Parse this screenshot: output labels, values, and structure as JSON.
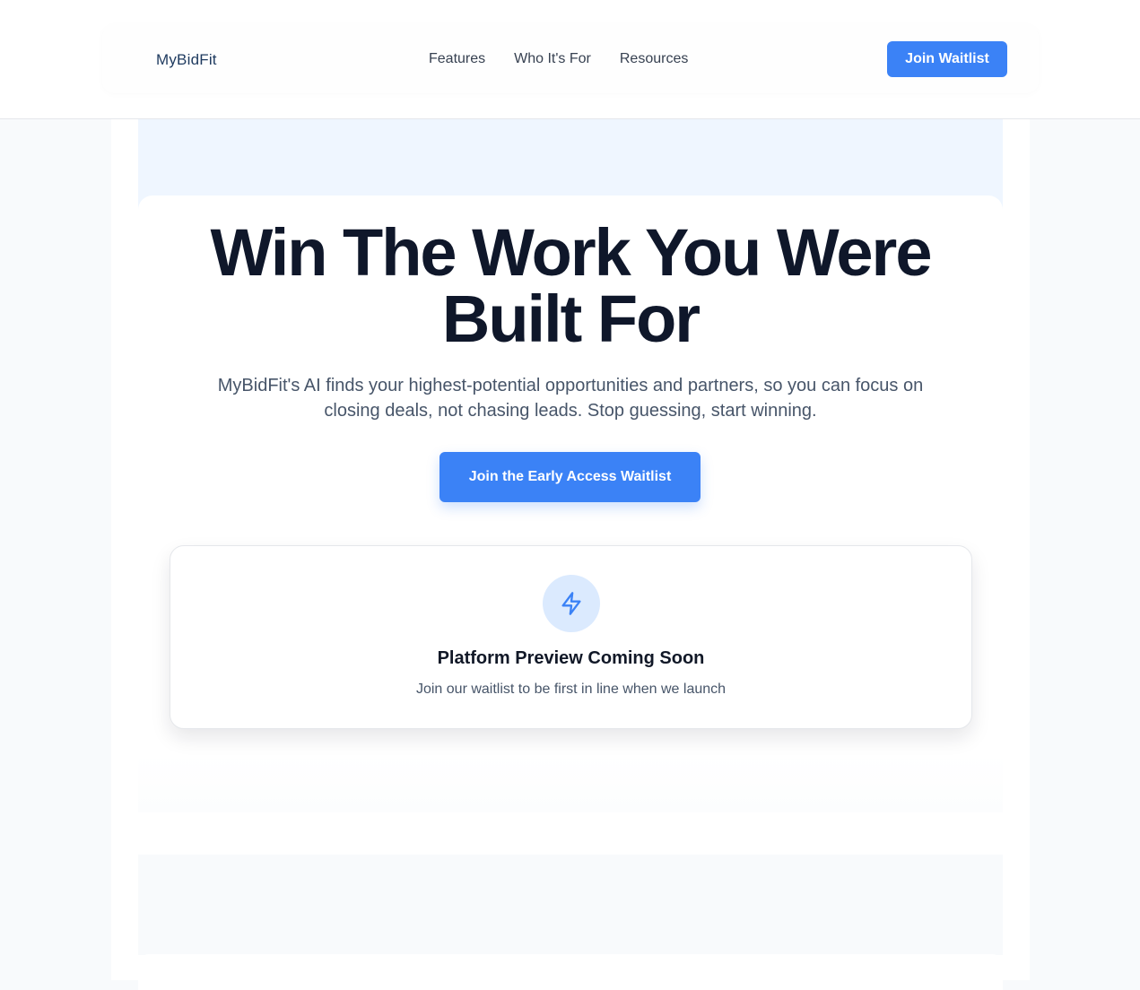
{
  "header": {
    "logo": "MyBidFit",
    "nav": [
      "Features",
      "Who It's For",
      "Resources"
    ],
    "cta_label": "Join Waitlist"
  },
  "hero": {
    "headline_line1": "Win The Work You Were",
    "headline_line2": "Built For",
    "subtext": "MyBidFit's AI finds your highest-potential opportunities and partners, so you can focus on closing deals, not chasing leads. Stop guessing, start winning.",
    "cta_label": "Join the Early Access Waitlist"
  },
  "preview": {
    "icon": "lightning-bolt-icon",
    "title": "Platform Preview Coming Soon",
    "subtitle": "Join our waitlist to be first in line when we launch"
  },
  "colors": {
    "accent": "#3b82f6",
    "heading": "#0f172a",
    "body_text": "#475569",
    "icon_bg": "#dbeafe"
  }
}
